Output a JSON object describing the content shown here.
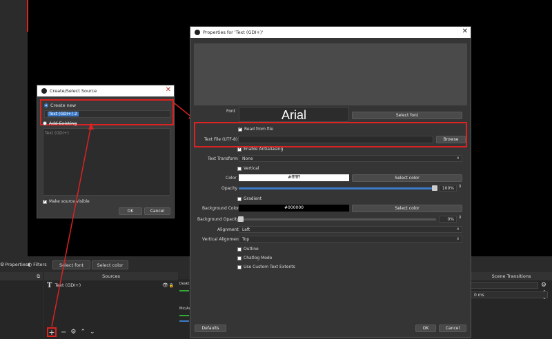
{
  "toolbar": {
    "properties": "Properties",
    "filters": "Filters",
    "select_font": "Select font",
    "select_color": "Select color"
  },
  "docks": {
    "sources_title": "Sources",
    "scene_transitions_title": "Scene Transitions",
    "source_item": "Text (GDI+)",
    "mixer_desktop": "Deskt",
    "mixer_mic": "Mic/Au",
    "duration": "0 ms"
  },
  "create_dialog": {
    "title": "Create/Select Source",
    "create_new_label": "Create new",
    "name_value": "Text (GDI+) 2",
    "add_existing_label": "Add Existing",
    "existing_item": "Text (GDI+)",
    "make_visible_label": "Make source visible",
    "ok": "OK",
    "cancel": "Cancel"
  },
  "properties_dialog": {
    "title": "Properties for 'Text (GDI+)'",
    "font_label": "Font",
    "font_preview": "Arial",
    "select_font_button": "Select font",
    "read_from_file_label": "Read from file",
    "text_file_label": "Text File (UTF-8)",
    "browse_button": "Browse",
    "antialias_label": "Enable Antialiasing",
    "text_transform_label": "Text Transform",
    "text_transform_value": "None",
    "vertical_label": "Vertical",
    "color_label": "Color",
    "color_value": "#ffffff",
    "select_color_button": "Select color",
    "opacity_label": "Opacity",
    "opacity_value": "100%",
    "opacity_fraction": 1.0,
    "gradient_label": "Gradient",
    "bg_color_label": "Background Color",
    "bg_color_value": "#000000",
    "bg_select_color_button": "Select color",
    "bg_opacity_label": "Background Opacity",
    "bg_opacity_value": "0%",
    "alignment_label": "Alignment",
    "alignment_value": "Left",
    "valign_label": "Vertical Alignment",
    "valign_value": "Top",
    "outline_label": "Outline",
    "chatlog_label": "Chatlog Mode",
    "extents_label": "Use Custom Text Extents",
    "defaults_button": "Defaults",
    "ok_button": "OK",
    "cancel_button": "Cancel"
  },
  "colors": {
    "highlight_red": "#d22222",
    "slider_blue": "#3d7cc9"
  }
}
